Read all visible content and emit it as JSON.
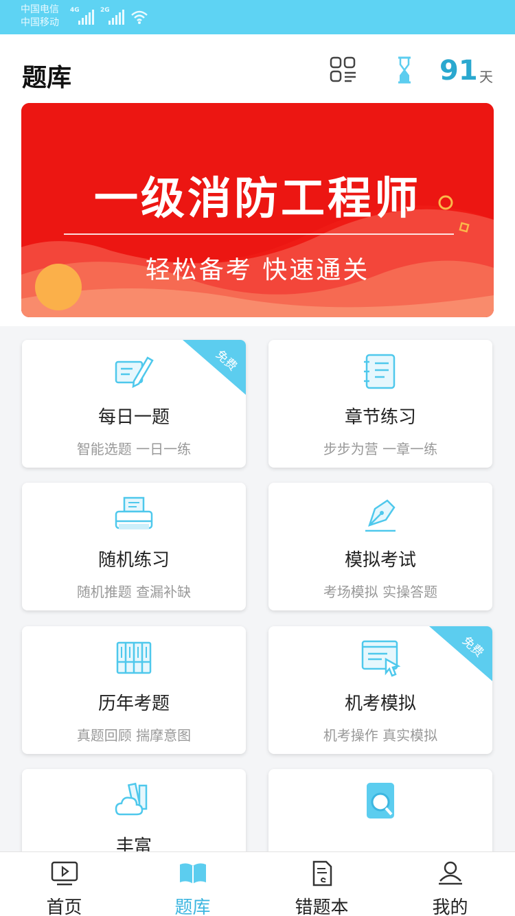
{
  "status_bar": {
    "carrier_1": "中国电信",
    "carrier_2": "中国移动",
    "network_1": "4G",
    "network_2": "2G"
  },
  "header": {
    "title": "题库",
    "countdown_value": "91",
    "countdown_unit": "天"
  },
  "banner": {
    "title": "一级消防工程师",
    "subtitle": "轻松备考 快速通关"
  },
  "cards": [
    {
      "title": "每日一题",
      "subtitle": "智能选题 一日一练",
      "icon": "pencil-paper-icon",
      "badge": "免费"
    },
    {
      "title": "章节练习",
      "subtitle": "步步为营 一章一练",
      "icon": "notebook-icon",
      "badge": ""
    },
    {
      "title": "随机练习",
      "subtitle": "随机推题 查漏补缺",
      "icon": "printer-icon",
      "badge": ""
    },
    {
      "title": "模拟考试",
      "subtitle": "考场模拟 实操答题",
      "icon": "pen-nib-icon",
      "badge": ""
    },
    {
      "title": "历年考题",
      "subtitle": "真题回顾 揣摩意图",
      "icon": "archive-icon",
      "badge": ""
    },
    {
      "title": "机考模拟",
      "subtitle": "机考操作 真实模拟",
      "icon": "computer-cursor-icon",
      "badge": "免费"
    },
    {
      "title": "丰富",
      "subtitle": "",
      "icon": "books-cloud-icon",
      "badge": ""
    },
    {
      "title": "",
      "subtitle": "",
      "icon": "phone-search-icon",
      "badge": ""
    }
  ],
  "tabbar": [
    {
      "label": "首页",
      "icon": "video-play-icon"
    },
    {
      "label": "题库",
      "icon": "open-book-icon"
    },
    {
      "label": "错题本",
      "icon": "document-icon"
    },
    {
      "label": "我的",
      "icon": "user-icon"
    }
  ],
  "colors": {
    "status_bar": "#5ed3f3",
    "accent": "#3cb6e0",
    "countdown": "#2aa8cf",
    "banner_red": "#ef1b15",
    "badge": "#5ccdef"
  }
}
